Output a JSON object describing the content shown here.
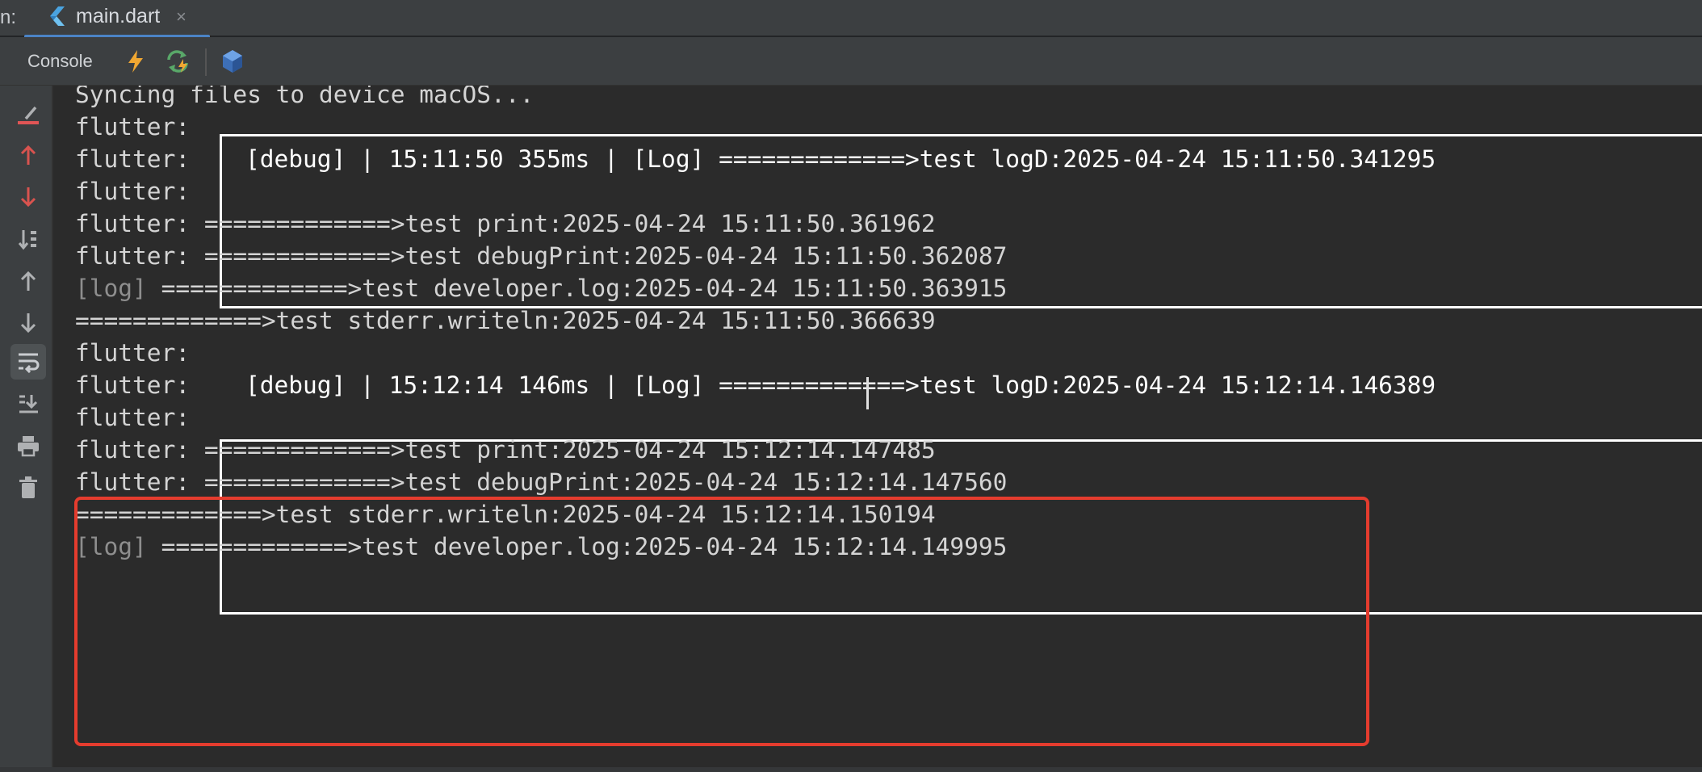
{
  "tabbar": {
    "prefix": "n:",
    "tab_label": "main.dart",
    "tab_close": "×",
    "tab_icon": "dart-file-icon"
  },
  "toolbar": {
    "console_label": "Console",
    "icons": [
      "hot-reload-icon",
      "hot-restart-icon",
      "dart-devtools-icon"
    ]
  },
  "gutter": {
    "icons": [
      "clear-console-icon",
      "previous-occurrence-icon",
      "next-occurrence-icon",
      "sort-icon",
      "scroll-up-icon",
      "scroll-down-icon",
      "soft-wrap-icon",
      "scroll-to-end-icon",
      "print-icon",
      "trash-icon"
    ]
  },
  "console": {
    "lines": [
      {
        "text": "Syncing files to device macOS..."
      },
      {
        "prefix": "flutter:"
      },
      {
        "prefix": "flutter:",
        "content": "[debug] | 15:11:50 355ms | [Log] =============>test logD:2025-04-24 15:11:50.341295"
      },
      {
        "prefix": "flutter:"
      },
      {
        "text": "flutter: =============>test print:2025-04-24 15:11:50.361962"
      },
      {
        "text": "flutter: =============>test debugPrint:2025-04-24 15:11:50.362087"
      },
      {
        "tag": "[log]",
        "text": " =============>test developer.log:2025-04-24 15:11:50.363915"
      },
      {
        "text": "=============>test stderr.writeln:2025-04-24 15:11:50.366639"
      },
      {
        "prefix": "flutter:"
      },
      {
        "prefix": "flutter:",
        "content": "[debug] | 15:12:14 146ms | [Log] =============>test logD:2025-04-24 15:12:14.146389"
      },
      {
        "prefix": "flutter:"
      },
      {
        "text": "flutter: =============>test print:2025-04-24 15:12:14.147485"
      },
      {
        "text": "flutter: =============>test debugPrint:2025-04-24 15:12:14.147560"
      },
      {
        "text": "=============>test stderr.writeln:2025-04-24 15:12:14.150194"
      },
      {
        "tag": "[log]",
        "text": " =============>test developer.log:2025-04-24 15:12:14.149995"
      }
    ]
  },
  "colors": {
    "highlight_border": "#e53c2e",
    "tab_underline": "#4b83c5",
    "background": "#2b2b2b"
  }
}
